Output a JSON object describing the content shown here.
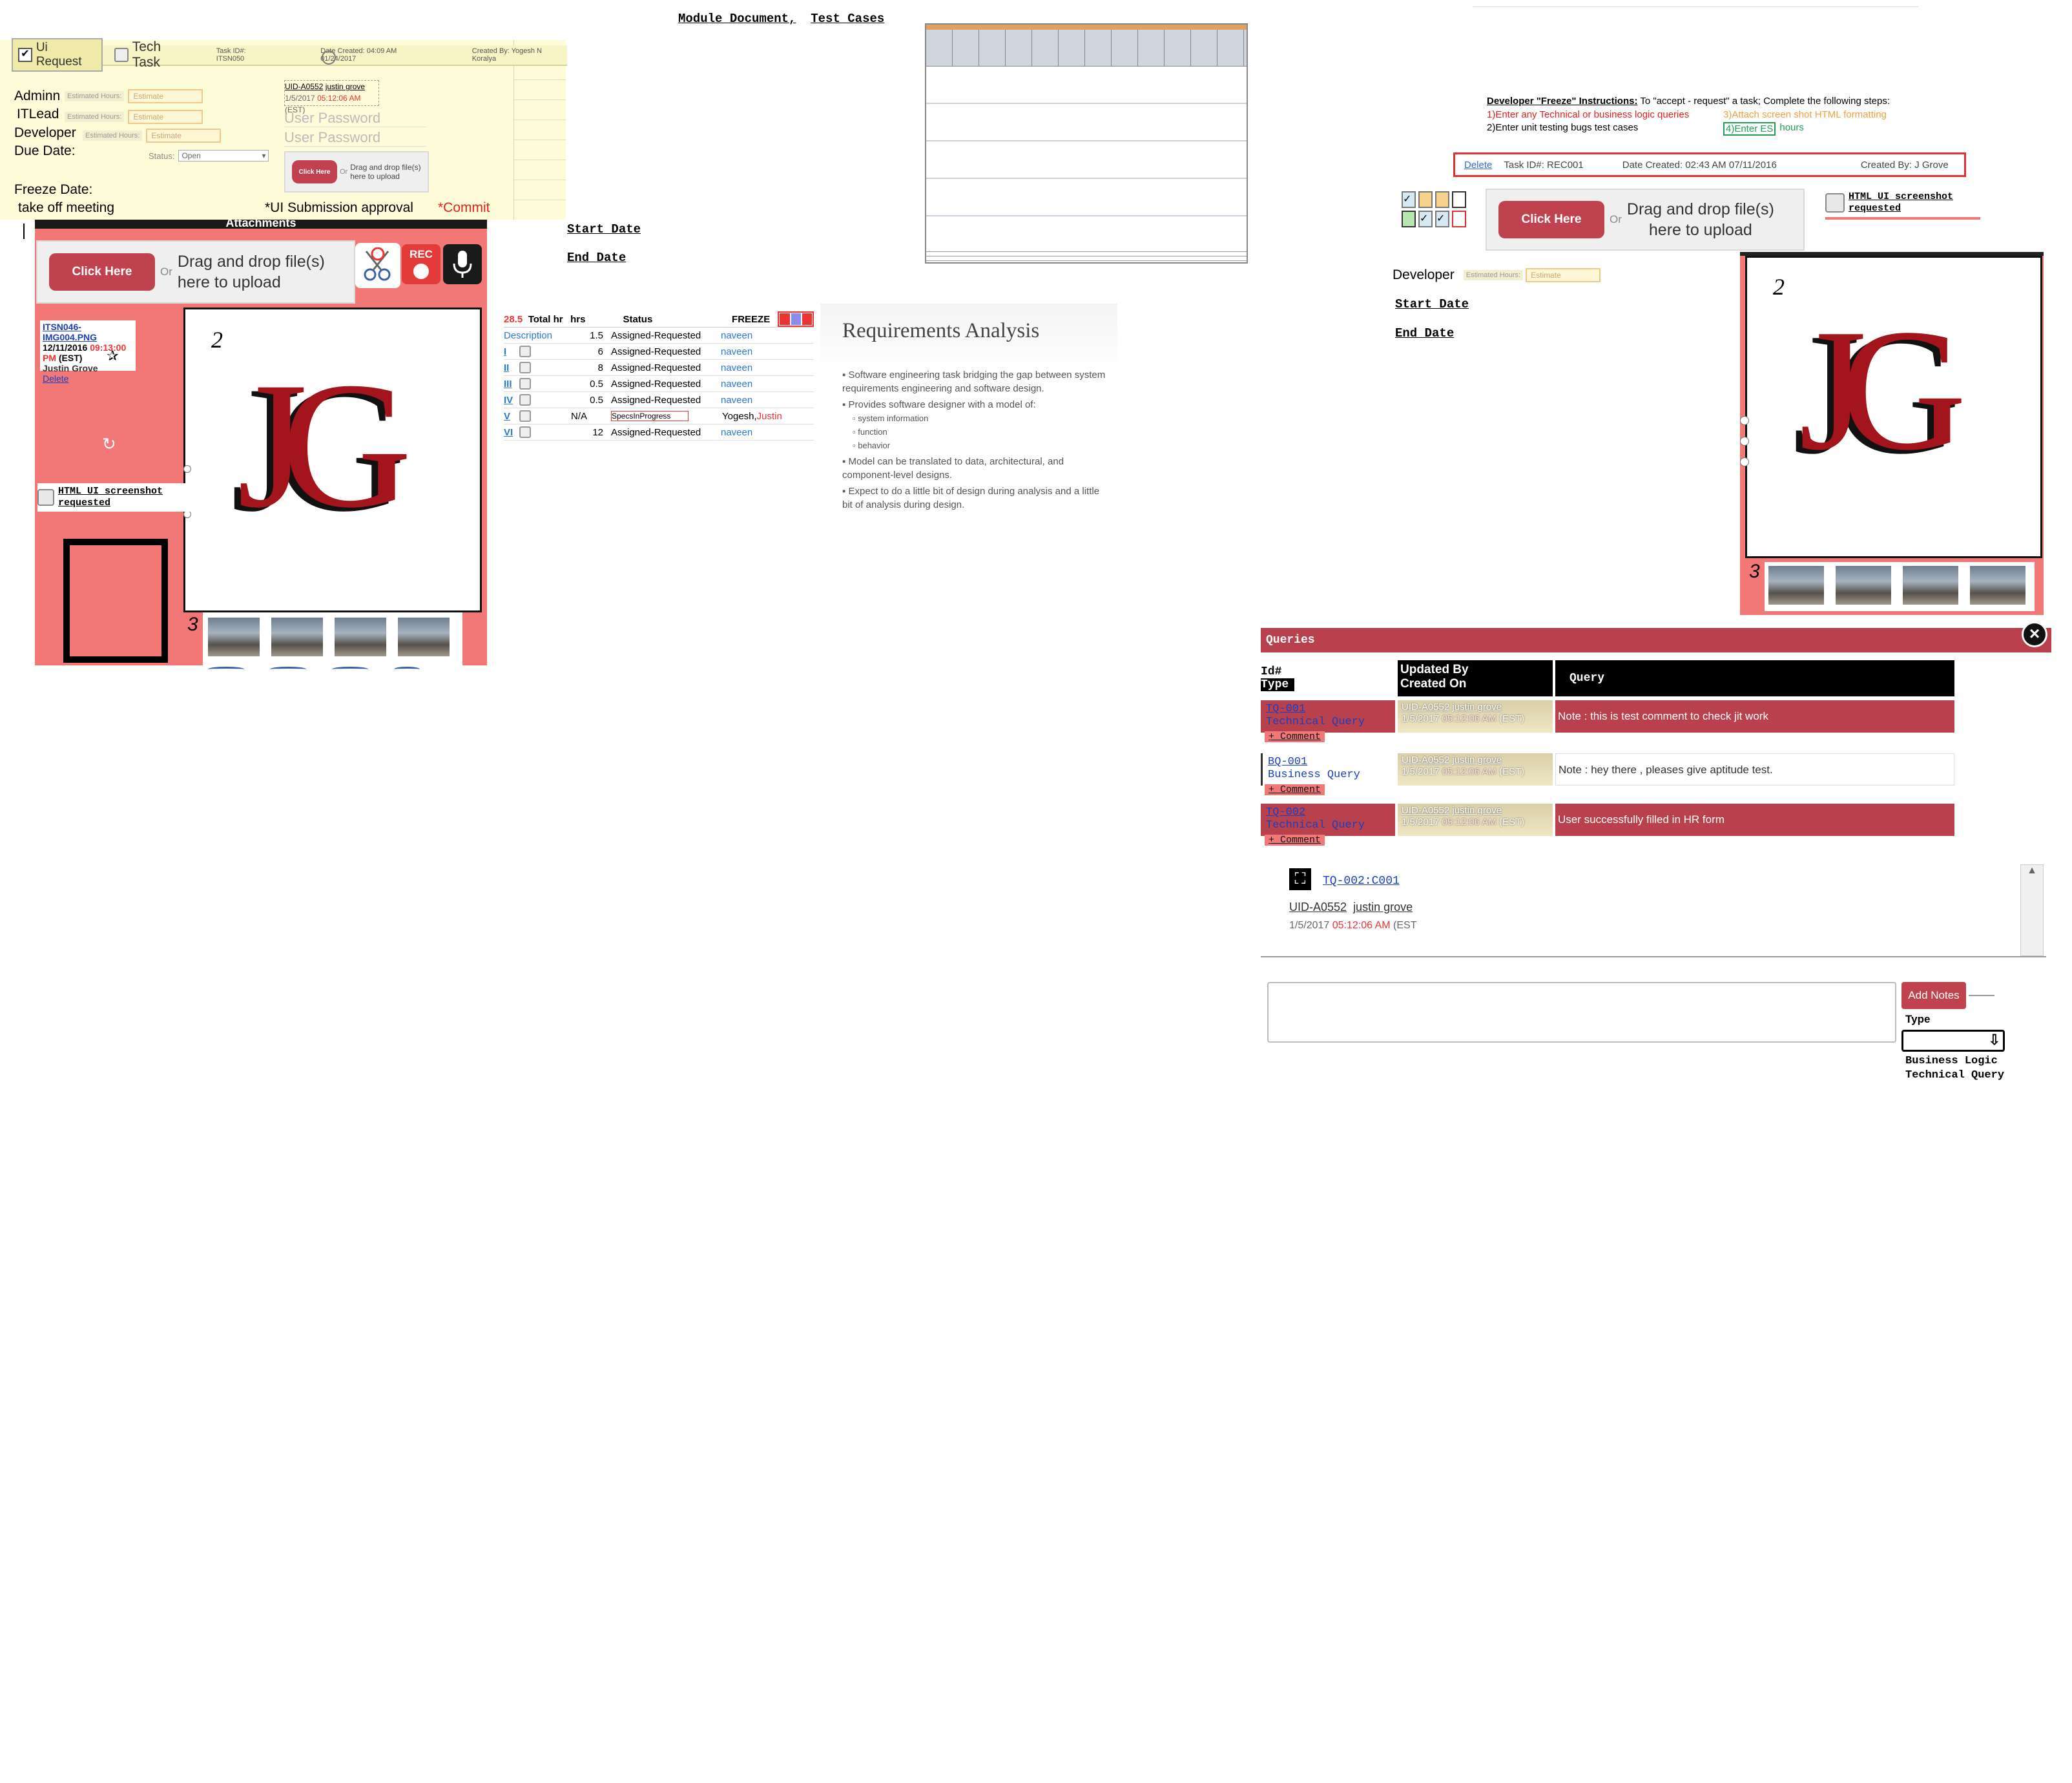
{
  "top": {
    "module_doc": "Module Document,",
    "test_cases": "Test Cases"
  },
  "task_card": {
    "ui_request": "Ui Request",
    "tech_task": "Tech Task",
    "task_id": "Task ID#: ITSN050",
    "date_created": "Date Created: 04:09 AM 01/24/2017",
    "created_by": "Created By: Yogesh N Koralya",
    "roles": [
      "Adminn",
      "ITLead",
      "Developer"
    ],
    "due_date": "Due Date:",
    "estimated_hours": "Estimated Hours:",
    "estimate_placeholder": "Estimate",
    "uid_user": "UID-A0552",
    "uid_name": "justin grove",
    "uid_date": "1/5/2017",
    "uid_time": "05:12:06 AM",
    "uid_tz": "(EST)",
    "user_password": "User Password",
    "status_label": "Status:",
    "status_value": "Open",
    "click_here": "Click Here",
    "or": "Or",
    "drag_drop": "Drag and drop file(s) here to upload",
    "freeze_date": "Freeze Date:",
    "kickoff": "take off meeting",
    "ui_submission": "*UI Submission approval",
    "commit": "*Commit"
  },
  "attachments": {
    "header": "Attachments",
    "click_here": "Click Here",
    "or": "Or",
    "drag_line1": "Drag and drop file(s)",
    "drag_line2": "here to upload",
    "rec": "REC",
    "file_name": "ITSN046-IMG004.PNG",
    "file_date": "12/11/2016",
    "file_time": "09:13:00 PM",
    "file_tz": "(EST)",
    "file_user": "Justin Grove",
    "delete": "Delete",
    "html_ui_line1": "HTML UI screenshot",
    "html_ui_line2": "requested",
    "logo": "JG",
    "page_num_2": "2",
    "page_num_3": "3"
  },
  "dates_a": {
    "start": "Start Date",
    "end": "End Date"
  },
  "hours_table": {
    "total_value": "28.5",
    "headers": [
      "Total hr",
      "hrs",
      "Status",
      "",
      "FREEZE"
    ],
    "rows": [
      {
        "label": "Description",
        "hrs": "1.5",
        "status": "Assigned-Requested",
        "who": "naveen"
      },
      {
        "label": "I",
        "hrs": "6",
        "status": "Assigned-Requested",
        "who": "naveen"
      },
      {
        "label": "II",
        "hrs": "8",
        "status": "Assigned-Requested",
        "who": "naveen"
      },
      {
        "label": "III",
        "hrs": "0.5",
        "status": "Assigned-Requested",
        "who": "naveen"
      },
      {
        "label": "IV",
        "hrs": "0.5",
        "status": "Assigned-Requested",
        "who": "naveen"
      },
      {
        "label": "V",
        "hrs": "N/A",
        "status": "SpecsInProgress",
        "who": "Yogesh,",
        "who2": "Justin"
      },
      {
        "label": "VI",
        "hrs": "12",
        "status": "Assigned-Requested",
        "who": "naveen"
      }
    ]
  },
  "slide": {
    "title": "Requirements Analysis",
    "bullets": [
      "Software engineering task bridging the gap between system requirements engineering and software design.",
      "Provides software designer with a model of:"
    ],
    "sub": [
      "system information",
      "function",
      "behavior"
    ],
    "bullets2": [
      "Model can be translated to data, architectural, and component-level designs.",
      "Expect to do a little bit of design during analysis and a little bit of analysis during design."
    ]
  },
  "freeze": {
    "title": "Developer \"Freeze\" Instructions:",
    "intro": "To \"accept - request\" a task; Complete the following steps:",
    "step1": "1)Enter any Technical or business logic queries",
    "step2": "2)Enter unit testing bugs test cases",
    "step3": "3)Attach screen shot HTML formatting",
    "step4": "4)Enter ES",
    "hours": "hours"
  },
  "task_bar": {
    "delete": "Delete",
    "task_id": "Task ID#: REC001",
    "date_created": "Date Created: 02:43 AM 07/11/2016",
    "created_by": "Created By: J Grove"
  },
  "right_upload": {
    "click_here": "Click Here",
    "or": "Or",
    "drag_line1": "Drag and drop file(s)",
    "drag_line2": "here to upload",
    "html_ui_line1": "HTML UI screenshot",
    "html_ui_line2": "requested",
    "developer": "Developer",
    "estimated_hours": "Estimated Hours:",
    "estimate_placeholder": "Estimate",
    "start": "Start Date",
    "end": "End Date",
    "logo": "JG",
    "page_num_2": "2",
    "page_num_3": "3"
  },
  "queries": {
    "title": "Queries",
    "col_id": "Id#",
    "col_type": "Type",
    "col_updated": "Updated By",
    "col_created": "Created On",
    "col_query": "Query",
    "rows": [
      {
        "id": "TQ-001",
        "type": "Technical Query",
        "user": "UID-A0552",
        "name": "justin grove",
        "date": "1/5/2017",
        "time": "05:12:06 AM",
        "tz": "(EST)",
        "query": "Note : this is test comment to check jit work",
        "style": "red"
      },
      {
        "id": "BQ-001",
        "type": "Business Query",
        "user": "UID-A0552",
        "name": "justin grove",
        "date": "1/5/2017",
        "time": "05:12:06 AM",
        "tz": "(EST)",
        "query": "Note : hey there , pleases give aptitude test.",
        "style": "white"
      },
      {
        "id": "TQ-002",
        "type": "Technical Query",
        "user": "UID-A0552",
        "name": "justin grove",
        "date": "1/5/2017",
        "time": "05:12:06 AM",
        "tz": "(EST)",
        "query": "User successfully filled in HR form",
        "style": "red"
      }
    ],
    "comment": "+ Comment",
    "sub_id": "TQ-002:C001",
    "sub_user": "UID-A0552",
    "sub_name": "justin grove",
    "sub_date": "1/5/2017",
    "sub_time": "05:12:06 AM",
    "sub_tz": "(EST",
    "add_notes": "Add Notes",
    "type_label": "Type",
    "type_opt1": "Business Logic",
    "type_opt2": "Technical Query",
    "close": "×"
  },
  "colors": {
    "accent": "#c0424e",
    "pink": "#f27878",
    "cream": "#fdfbd8",
    "query_red": "#b8414d",
    "link": "#1a3fbf"
  }
}
